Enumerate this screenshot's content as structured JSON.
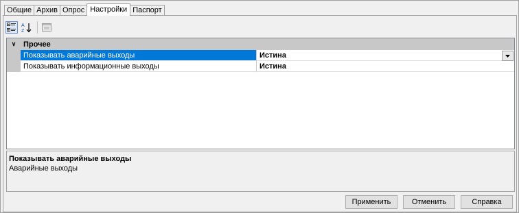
{
  "tabs": [
    {
      "label": "Общие"
    },
    {
      "label": "Архив"
    },
    {
      "label": "Опрос"
    },
    {
      "label": "Настройки"
    },
    {
      "label": "Паспорт"
    }
  ],
  "active_tab": "Настройки",
  "toolbar": {
    "categorized_icon": "categorized-icon",
    "alphabetical_icon": "sort-alphabetical-icon",
    "property_pages_icon": "property-pages-icon"
  },
  "property_grid": {
    "category": "Прочее",
    "rows": [
      {
        "name": "Показывать аварийные выходы",
        "value": "Истина",
        "selected": true
      },
      {
        "name": "Показывать информационные выходы",
        "value": "Истина",
        "selected": false
      }
    ]
  },
  "description": {
    "title": "Показывать аварийные выходы",
    "text": "Аварийные выходы"
  },
  "buttons": {
    "apply": "Применить",
    "cancel": "Отменить",
    "help": "Справка"
  },
  "colors": {
    "selection": "#0078d7",
    "category_bg": "#c8c8c8"
  }
}
